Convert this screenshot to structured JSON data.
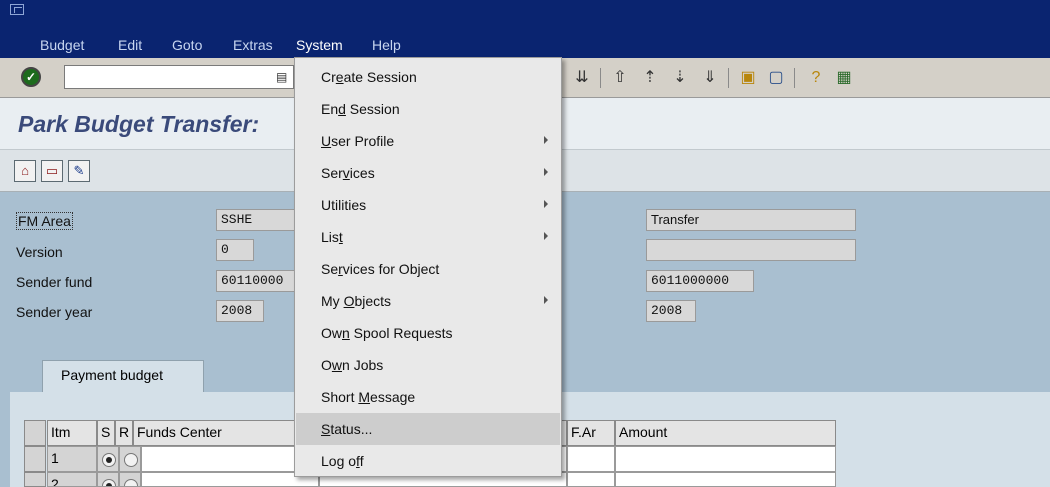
{
  "menubar": {
    "items": [
      "Budget",
      "Edit",
      "Goto",
      "Extras",
      "System",
      "Help"
    ]
  },
  "toolbar": {
    "command_value": "",
    "icons": [
      "enter-icon",
      "save-icon",
      "back-icon",
      "exit-icon",
      "cancel-icon",
      "print-icon",
      "find-icon",
      "find-next-icon",
      "first-page-icon",
      "previous-page-icon",
      "next-page-icon",
      "last-page-icon",
      "new-session-icon",
      "shortcut-icon",
      "help-icon",
      "layout-icon"
    ]
  },
  "title": "Park Budget Transfer:",
  "form": {
    "fm_area_label": "FM Area",
    "fm_area_value": "SSHE",
    "version_label": "Version",
    "version_value": "0",
    "sender_fund_label": "Sender fund",
    "sender_fund_value": "60110000",
    "sender_year_label": "Sender year",
    "sender_year_value": "2008",
    "right_1": "Transfer",
    "right_2": "",
    "right_3": "6011000000",
    "right_4": "2008"
  },
  "tab": {
    "label": "Payment budget"
  },
  "table": {
    "headers": [
      "Itm",
      "S",
      "R",
      "Funds Center",
      "F.Ar",
      "Amount"
    ],
    "rows": [
      {
        "itm": "1",
        "s_selected": true,
        "r_selected": false
      },
      {
        "itm": "2",
        "s_selected": true,
        "r_selected": false
      }
    ]
  },
  "dropdown": {
    "items": [
      {
        "before": "Cr",
        "ul": "e",
        "after": "ate Session",
        "submenu": false
      },
      {
        "before": "En",
        "ul": "d",
        "after": " Session",
        "submenu": false
      },
      {
        "before": "",
        "ul": "U",
        "after": "ser Profile",
        "submenu": true
      },
      {
        "before": "Ser",
        "ul": "v",
        "after": "ices",
        "submenu": true
      },
      {
        "before": "Utilities",
        "ul": "",
        "after": "",
        "submenu": true
      },
      {
        "before": "Lis",
        "ul": "t",
        "after": "",
        "submenu": true
      },
      {
        "before": "Se",
        "ul": "r",
        "after": "vices for Object",
        "submenu": false
      },
      {
        "before": "My ",
        "ul": "O",
        "after": "bjects",
        "submenu": true
      },
      {
        "before": "Ow",
        "ul": "n",
        "after": " Spool Requests",
        "submenu": false
      },
      {
        "before": "O",
        "ul": "w",
        "after": "n Jobs",
        "submenu": false
      },
      {
        "before": "Short ",
        "ul": "M",
        "after": "essage",
        "submenu": false
      },
      {
        "before": "",
        "ul": "S",
        "after": "tatus...",
        "submenu": false
      },
      {
        "before": "Log o",
        "ul": "f",
        "after": "f",
        "submenu": false
      }
    ]
  },
  "colors": {
    "menubar": "#0a2470",
    "title_text": "#3a4a7a",
    "form_background": "#a9bfd0"
  }
}
